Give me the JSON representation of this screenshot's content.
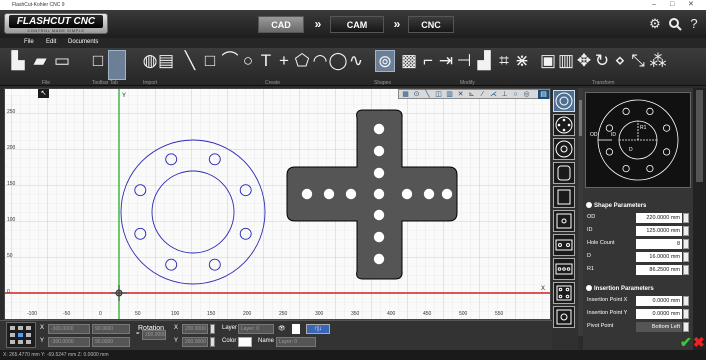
{
  "window": {
    "title": "FlashCut-Kohler CNC 9",
    "minimize": "–",
    "maximize": "□",
    "close": "✕"
  },
  "logo": {
    "text": "FLASHCUT CNC",
    "tagline": "CONTROL MADE SIMPLE"
  },
  "modes": [
    {
      "label": "CAD",
      "active": true
    },
    {
      "label": "CAM",
      "active": false
    },
    {
      "label": "CNC",
      "active": false
    }
  ],
  "header_icons": [
    "settings-icon",
    "search-icon",
    "help-icon"
  ],
  "help_glyph": "?",
  "menu": [
    "File",
    "Edit",
    "Documents"
  ],
  "toolbar_groups": {
    "file": "File",
    "toolbar_tab": "Toolbar Tab",
    "import": "Import",
    "create": "Create",
    "shapes": "Shapes",
    "modify": "Modify",
    "transform": "Transform"
  },
  "canvas": {
    "x_ticks": [
      "-100",
      "-50",
      "0",
      "50",
      "100",
      "150",
      "200",
      "250",
      "300",
      "350",
      "400",
      "450",
      "500",
      "550"
    ],
    "y_ticks": [
      "250",
      "200",
      "150",
      "100",
      "50",
      "0"
    ],
    "y_axis_label": "Y",
    "x_axis_label": "X",
    "accent_axis_x": "#d32020",
    "accent_axis_y": "#33b533",
    "shape_color": "#2a2ab5",
    "plate_color": "#555555"
  },
  "transform_bar": {
    "field_placeholder": "-300.0000",
    "angle_placeholder": "90.0000",
    "rotation_label": "Rotation",
    "x_label": "X",
    "y_label": "Y",
    "xy_value": "200.0000",
    "layer_label": "Layer",
    "layer_placeholder": "Layer: 0",
    "color_label": "Color",
    "name_label": "Name",
    "name_placeholder": "Layer: 0"
  },
  "status": {
    "coords": "X: 265.4770 mm   Y: -69.5247 mm   Z: 0.0000 mm"
  },
  "shape_parameters": {
    "title": "Shape Parameters",
    "rows": [
      {
        "label": "OD",
        "value": "220.0000 mm"
      },
      {
        "label": "ID",
        "value": "125.0000 mm"
      },
      {
        "label": "Hole Count",
        "value": "8"
      },
      {
        "label": "D",
        "value": "16.0000 mm"
      },
      {
        "label": "R1",
        "value": "86.2500 mm"
      }
    ]
  },
  "insertion_parameters": {
    "title": "Insertion Parameters",
    "rows": [
      {
        "label": "Insertion Point X",
        "value": "0.0000 mm"
      },
      {
        "label": "Insertion Point Y",
        "value": "0.0000 mm"
      },
      {
        "label": "Pivot Point",
        "value": "Bottom Left"
      }
    ]
  },
  "preview_labels": {
    "od": "OD",
    "id": "ID",
    "r1": "R1",
    "d": "D"
  },
  "actions": {
    "ok": "✔",
    "cancel": "✖"
  }
}
